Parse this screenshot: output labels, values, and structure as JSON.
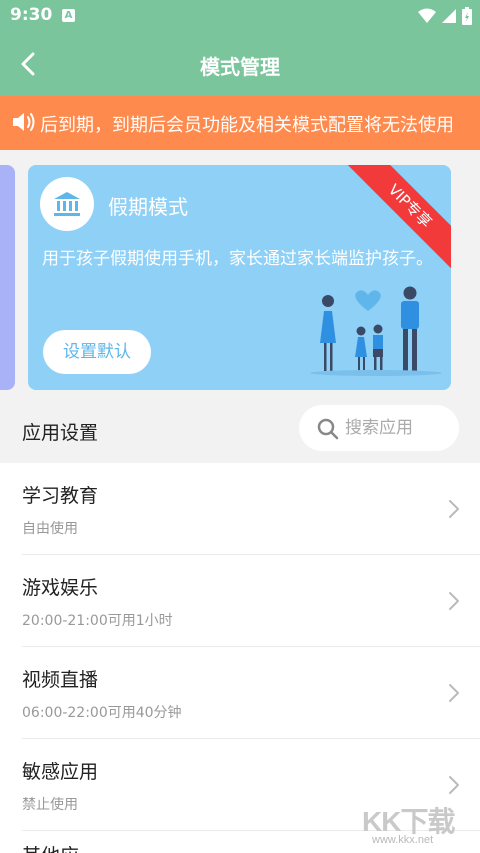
{
  "status_bar": {
    "time": "9:30",
    "notification_letter": "A"
  },
  "header": {
    "title": "模式管理"
  },
  "notice": {
    "text": "后到期，到期后会员功能及相关模式配置将无法使用"
  },
  "mode_card": {
    "title": "假期模式",
    "description": "用于孩子假期使用手机，家长通过家长端监护孩子。",
    "default_button": "设置默认",
    "ribbon": "VIP专享",
    "background_color": "#8fd0f7",
    "ribbon_color": "#f23a3a"
  },
  "app_settings": {
    "title": "应用设置",
    "search_placeholder": "搜索应用"
  },
  "categories": [
    {
      "title": "学习教育",
      "status": "自由使用"
    },
    {
      "title": "游戏娱乐",
      "status": "20:00-21:00可用1小时"
    },
    {
      "title": "视频直播",
      "status": "06:00-22:00可用40分钟"
    },
    {
      "title": "敏感应用",
      "status": "禁止使用"
    },
    {
      "title": "其他应"
    }
  ],
  "watermark": {
    "main": "KK下载",
    "url": "www.kkx.net"
  },
  "colors": {
    "theme": "#7ac59c",
    "notice": "#ff8a4d",
    "side_card": "#a9b2f7"
  },
  "icons": [
    "back-arrow-icon",
    "speaker-icon",
    "bank-icon",
    "search-icon",
    "chevron-right-icon",
    "wifi-icon",
    "signal-icon",
    "battery-icon"
  ]
}
